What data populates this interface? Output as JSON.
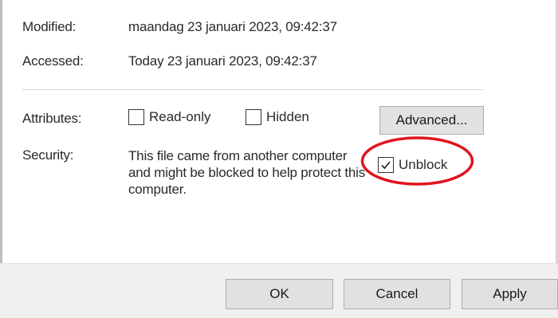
{
  "general": {
    "modified_label": "Modified:",
    "modified_value": "maandag 23 januari 2023, 09:42:37",
    "accessed_label": "Accessed:",
    "accessed_value": "Today 23 januari 2023, 09:42:37"
  },
  "attributes": {
    "label": "Attributes:",
    "read_only": {
      "label": "Read-only",
      "checked": false
    },
    "hidden": {
      "label": "Hidden",
      "checked": false
    },
    "advanced_button": "Advanced..."
  },
  "security": {
    "label": "Security:",
    "message": "This file came from another computer and might be blocked to help protect this computer.",
    "unblock": {
      "label": "Unblock",
      "checked": true
    }
  },
  "footer": {
    "ok": "OK",
    "cancel": "Cancel",
    "apply": "Apply"
  },
  "colors": {
    "highlight": "#e0141e",
    "footer_bg": "#f0f0f0",
    "button_bg": "#e1e1e1"
  }
}
